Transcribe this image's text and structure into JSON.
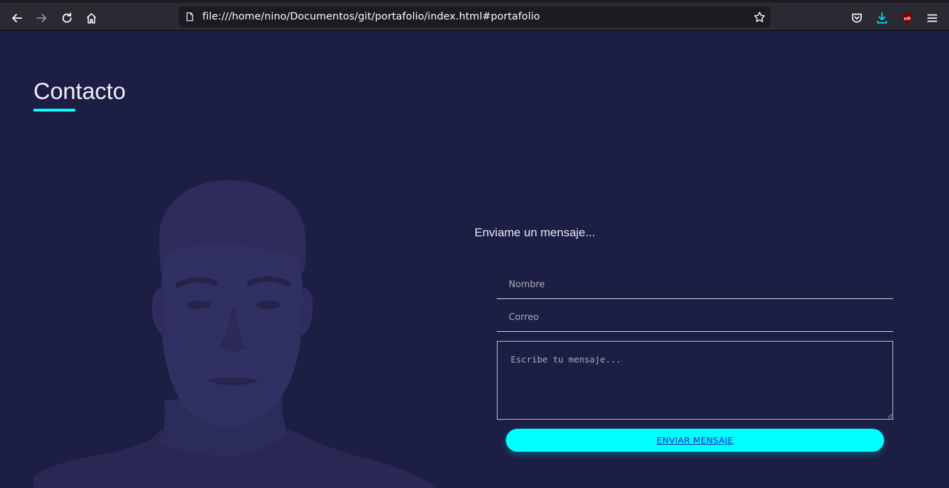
{
  "browser": {
    "url": "file:///home/nino/Documentos/git/portafolio/index.html#portafolio",
    "icons": [
      "back-arrow-icon",
      "forward-arrow-icon",
      "reload-icon",
      "home-icon",
      "page-icon",
      "bookmark-star-icon",
      "pocket-icon",
      "download-icon",
      "ublock-icon",
      "hamburger-menu-icon"
    ],
    "colors": {
      "toolbar": "#2b2a33",
      "urlbar": "#1c1b22",
      "download": "#00ddff",
      "ublock": "#800000"
    }
  },
  "page": {
    "title": "Contacto",
    "form": {
      "heading": "Enviame un mensaje...",
      "name_placeholder": "Nombre",
      "email_placeholder": "Correo",
      "message_placeholder": "Escribe tu mensaje...",
      "submit_label": "ENVIAR MENSAJE"
    },
    "colors": {
      "background": "#1c1e44",
      "accent": "#00ffff",
      "text": "#eef0ff"
    }
  }
}
